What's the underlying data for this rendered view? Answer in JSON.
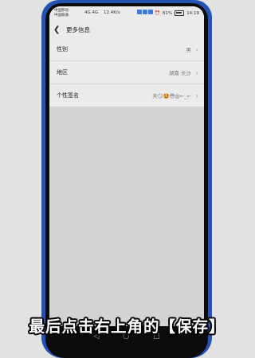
{
  "status_bar": {
    "carrier": "中国移动\n中国联通",
    "network": "4G 4G",
    "speed": "12.4K/s",
    "battery_percent": "81%",
    "time": "14:19"
  },
  "header": {
    "title": "更多信息"
  },
  "rows": [
    {
      "label": "性别",
      "value": "男"
    },
    {
      "label": "地区",
      "value": "湖南 长沙"
    },
    {
      "label": "个性签名",
      "value": "天😏🤩😳@←_←"
    }
  ],
  "nav": {
    "back": "◁",
    "home": "○",
    "recent": "□"
  },
  "caption": "最后点击右上角的【保存】"
}
